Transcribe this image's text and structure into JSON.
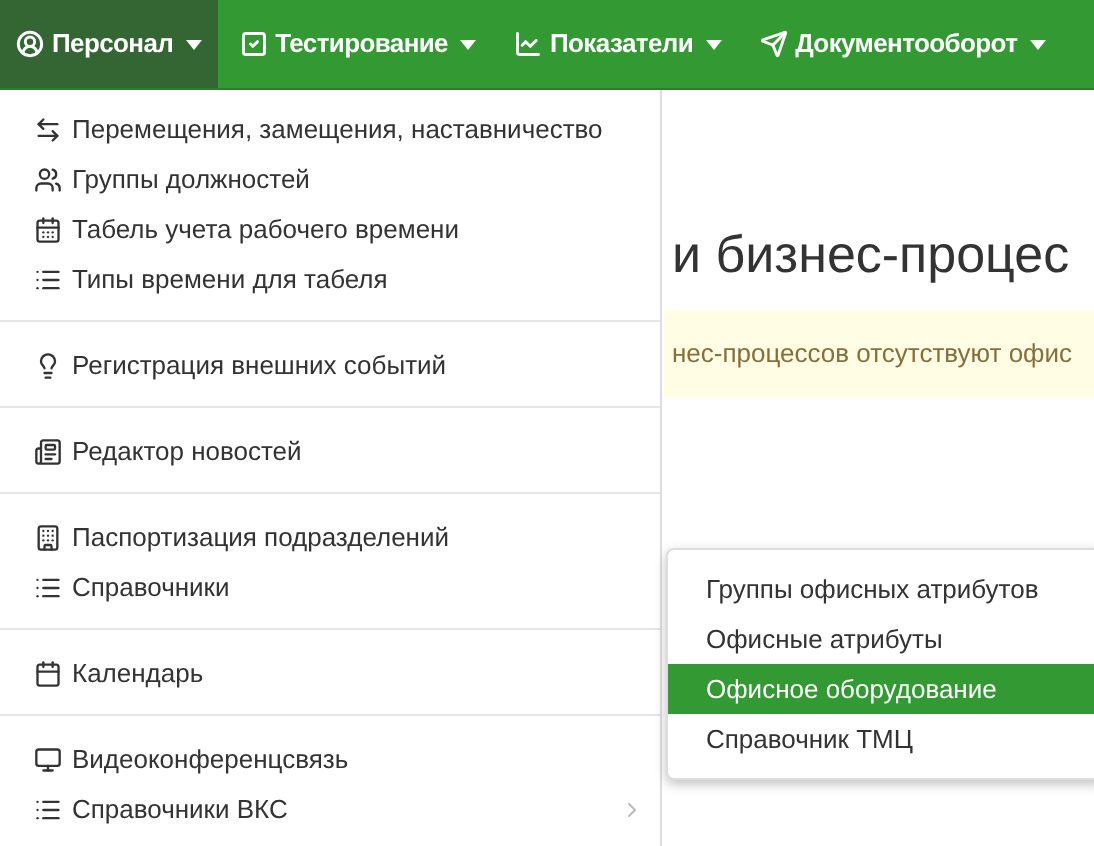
{
  "navbar": {
    "items": [
      {
        "label": "Персонал",
        "selected": true
      },
      {
        "label": "Тестирование",
        "selected": false
      },
      {
        "label": "Показатели",
        "selected": false
      },
      {
        "label": "Документооборот",
        "selected": false
      }
    ]
  },
  "page": {
    "heading": "и бизнес-процес",
    "alert": "нес-процессов отсутствуют офис"
  },
  "dropdown": {
    "sections": [
      {
        "items": [
          {
            "label": "Перемещения, замещения, наставничество",
            "has_submenu": false
          },
          {
            "label": "Группы должностей",
            "has_submenu": false
          },
          {
            "label": "Табель учета рабочего времени",
            "has_submenu": false
          },
          {
            "label": "Типы времени для табеля",
            "has_submenu": false
          }
        ]
      },
      {
        "items": [
          {
            "label": "Регистрация внешних событий",
            "has_submenu": false
          }
        ]
      },
      {
        "items": [
          {
            "label": "Редактор новостей",
            "has_submenu": false
          }
        ]
      },
      {
        "items": [
          {
            "label": "Паспортизация подразделений",
            "has_submenu": false
          },
          {
            "label": "Справочники",
            "has_submenu": false,
            "submenu": [
              {
                "label": "Группы офисных атрибутов",
                "selected": false
              },
              {
                "label": "Офисные атрибуты",
                "selected": false
              },
              {
                "label": "Офисное оборудование",
                "selected": true
              },
              {
                "label": "Справочник ТМЦ",
                "selected": false
              }
            ]
          }
        ]
      },
      {
        "items": [
          {
            "label": "Календарь",
            "has_submenu": false
          }
        ]
      },
      {
        "items": [
          {
            "label": "Видеоконференцсвязь",
            "has_submenu": false
          },
          {
            "label": "Справочники ВКС",
            "has_submenu": true
          }
        ]
      }
    ]
  }
}
